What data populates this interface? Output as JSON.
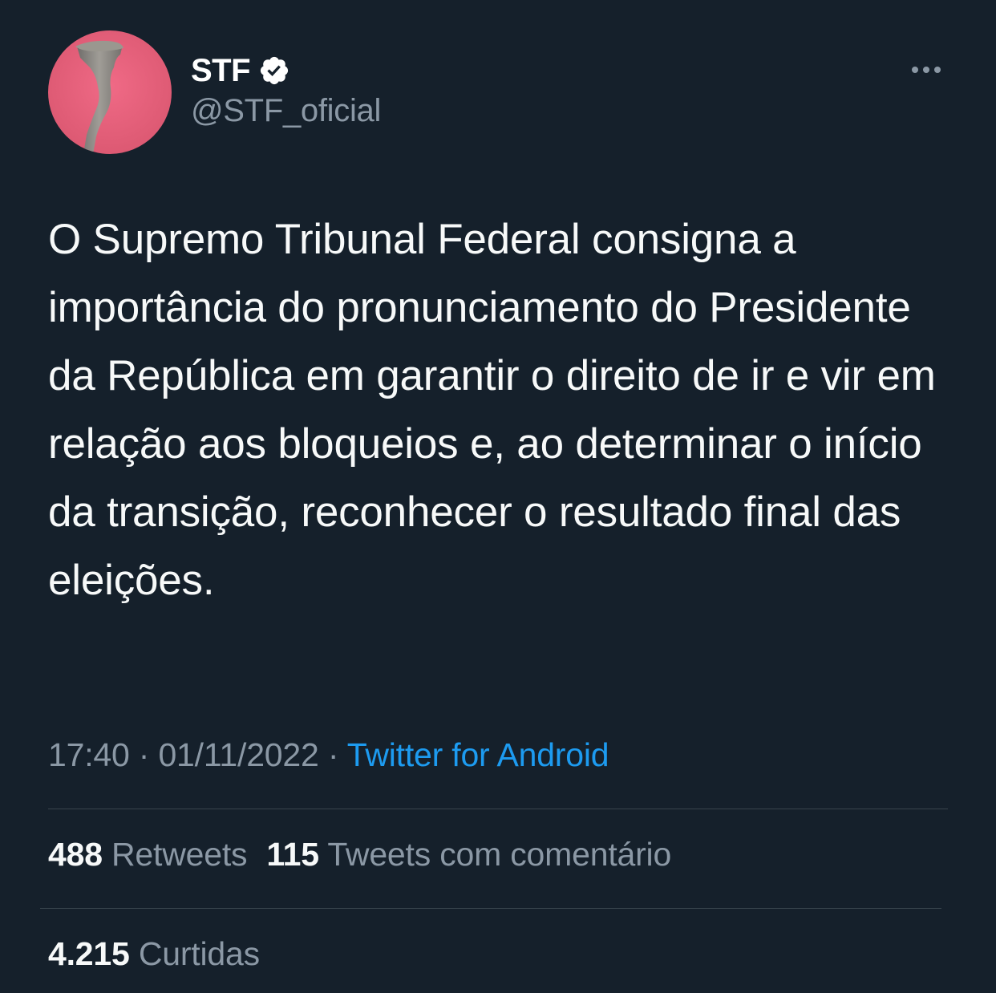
{
  "author": {
    "display_name": "STF",
    "handle": "@STF_oficial",
    "verified": true,
    "avatar_colors": {
      "background": "#e8607a",
      "statue": "#8c8a86"
    }
  },
  "tweet": {
    "text": "O Supremo Tribunal Federal consigna a importância do pronunciamento do Presidente da República em garantir o direito de ir e vir em relação aos bloqueios e, ao determinar o início da transição, reconhecer o resultado final das eleições."
  },
  "meta": {
    "time": "17:40",
    "separator": " · ",
    "date": "01/11/2022",
    "source": "Twitter for Android"
  },
  "stats": {
    "retweets_count": "488",
    "retweets_label": "Retweets",
    "quotes_count": "115",
    "quotes_label": "Tweets com comentário",
    "likes_count": "4.215",
    "likes_label": "Curtidas"
  },
  "colors": {
    "background": "#15202b",
    "accent": "#1d9bf0",
    "secondary_text": "#8b98a5",
    "divider": "#38444d"
  },
  "icons": {
    "verified": "verified-badge-icon",
    "more": "more-options-icon"
  }
}
